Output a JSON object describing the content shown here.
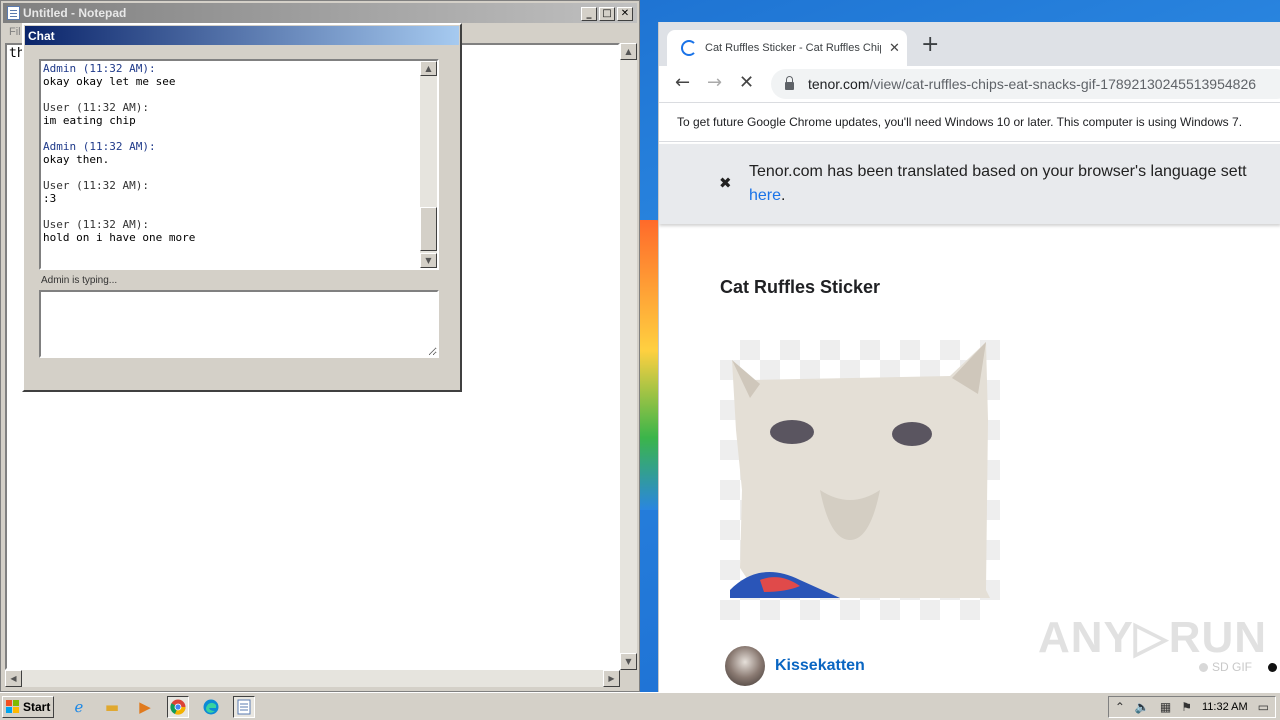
{
  "notepad": {
    "title": "Untitled - Notepad",
    "menu_text": "Fil",
    "content": "th",
    "buttons": {
      "minimize": "_",
      "maximize": "□",
      "close": "✕"
    }
  },
  "chat": {
    "title": "Chat",
    "messages": [
      {
        "header": "Admin (11:32 AM):",
        "text": "okay okay let me see"
      },
      {
        "header": "User (11:32 AM):",
        "text": "im eating chip"
      },
      {
        "header": "Admin (11:32 AM):",
        "text": "okay then."
      },
      {
        "header": "User (11:32 AM):",
        "text": ":3"
      },
      {
        "header": "User (11:32 AM):",
        "text": "hold on i have one more"
      }
    ],
    "typing_status": "Admin is typing...",
    "input_value": ""
  },
  "browser": {
    "tab_title": "Cat Ruffles Sticker - Cat Ruffles Chips",
    "url_host": "tenor.com",
    "url_path": "/view/cat-ruffles-chips-eat-snacks-gif-17892130245513954826",
    "infobar_text": "To get future Google Chrome updates, you'll need Windows 10 or later. This computer is using Windows 7.",
    "translate_text": "Tenor.com has been translated based on your browser's language sett",
    "translate_link": "here",
    "translate_suffix": ".",
    "page_title": "Cat Ruffles Sticker",
    "author": "Kissekatten",
    "sd_label": "SD GIF"
  },
  "watermark": "ANY▷RUN",
  "taskbar": {
    "start_label": "Start",
    "clock": "11:32 AM",
    "pinned": [
      "ie-icon",
      "explorer-icon",
      "media-player-icon",
      "chrome-icon",
      "edge-icon",
      "notepad-icon"
    ]
  },
  "colors": {
    "chat_title_start": "#0a246a",
    "chat_title_end": "#a6caf0",
    "link_blue": "#1a73e8",
    "author_blue": "#0a66c2"
  }
}
